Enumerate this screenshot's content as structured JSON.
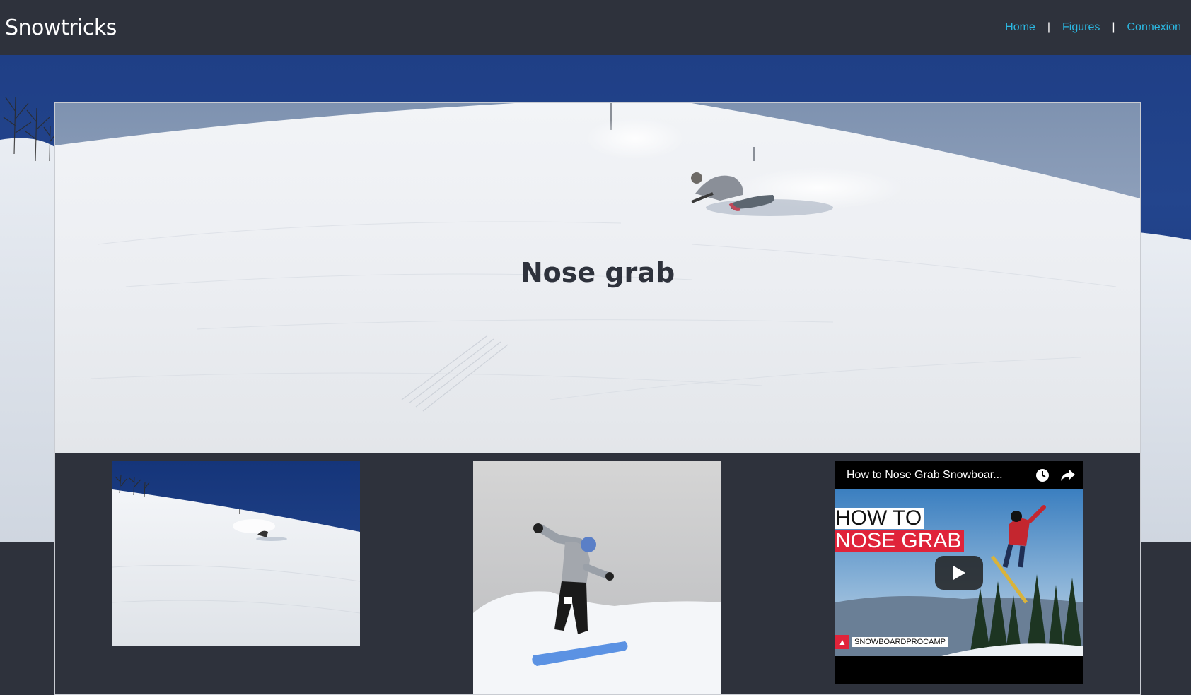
{
  "navbar": {
    "brand": "Snowtricks",
    "links": [
      {
        "label": "Home"
      },
      {
        "label": "Figures"
      },
      {
        "label": "Connexion"
      }
    ],
    "separator": "|",
    "link_color": "#2bb9e3"
  },
  "trick": {
    "title": "Nose grab"
  },
  "media": {
    "video": {
      "title": "How to Nose Grab Snowboar...",
      "overlay_line1": "HOW TO",
      "overlay_line2": "NOSE GRAB",
      "channel_badge": "SNOWBOARDPROCAMP",
      "icons": [
        "watch-later-icon",
        "share-icon",
        "play-icon"
      ]
    }
  },
  "colors": {
    "background": "#2e323c",
    "sky": "#1f3f86",
    "accent_red": "#e0233a"
  }
}
